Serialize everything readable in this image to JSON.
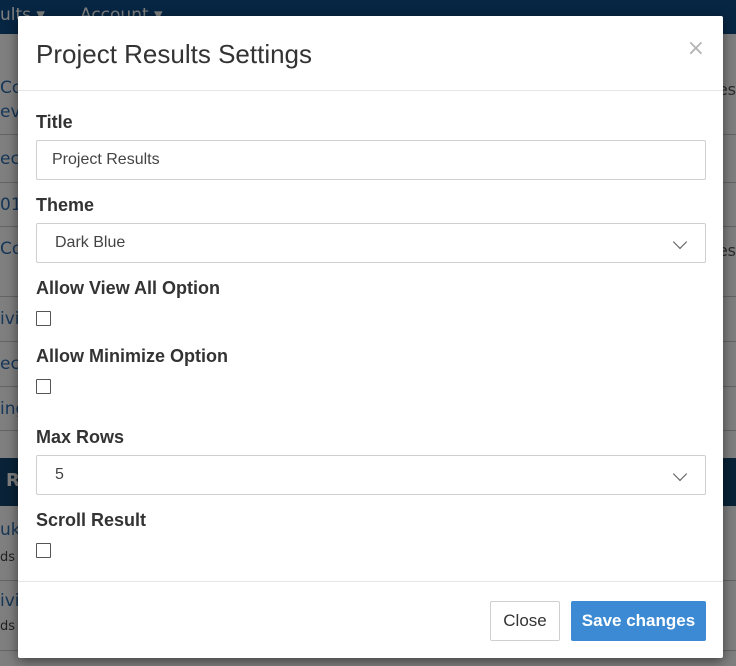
{
  "background": {
    "nav_items": [
      "ults ▾",
      "Account ▾"
    ],
    "rows": [
      {
        "text": "Co",
        "text2": "eve",
        "right": "es"
      },
      {
        "text": "ec"
      },
      {
        "text": "01"
      },
      {
        "text": "Co",
        "right": "es"
      },
      {
        "text": "ivi"
      },
      {
        "text": "ec"
      },
      {
        "text": "ing"
      }
    ],
    "band_label": "R",
    "lower_rows": [
      {
        "text": "uk C",
        "sub": "ds"
      },
      {
        "text": "ivi",
        "sub": "ds"
      }
    ]
  },
  "modal": {
    "title": "Project Results Settings",
    "close_symbol": "×",
    "fields": {
      "title_label": "Title",
      "title_value": "Project Results",
      "theme_label": "Theme",
      "theme_value": "Dark Blue",
      "allow_view_all_label": "Allow View All Option",
      "allow_view_all_checked": false,
      "allow_minimize_label": "Allow Minimize Option",
      "allow_minimize_checked": false,
      "max_rows_label": "Max Rows",
      "max_rows_value": "5",
      "scroll_result_label": "Scroll Result",
      "scroll_result_checked": false
    },
    "footer": {
      "close_label": "Close",
      "save_label": "Save changes"
    }
  },
  "colors": {
    "primary_button": "#3b8ad3",
    "nav": "#0f4d86",
    "link": "#2f6fb0"
  }
}
